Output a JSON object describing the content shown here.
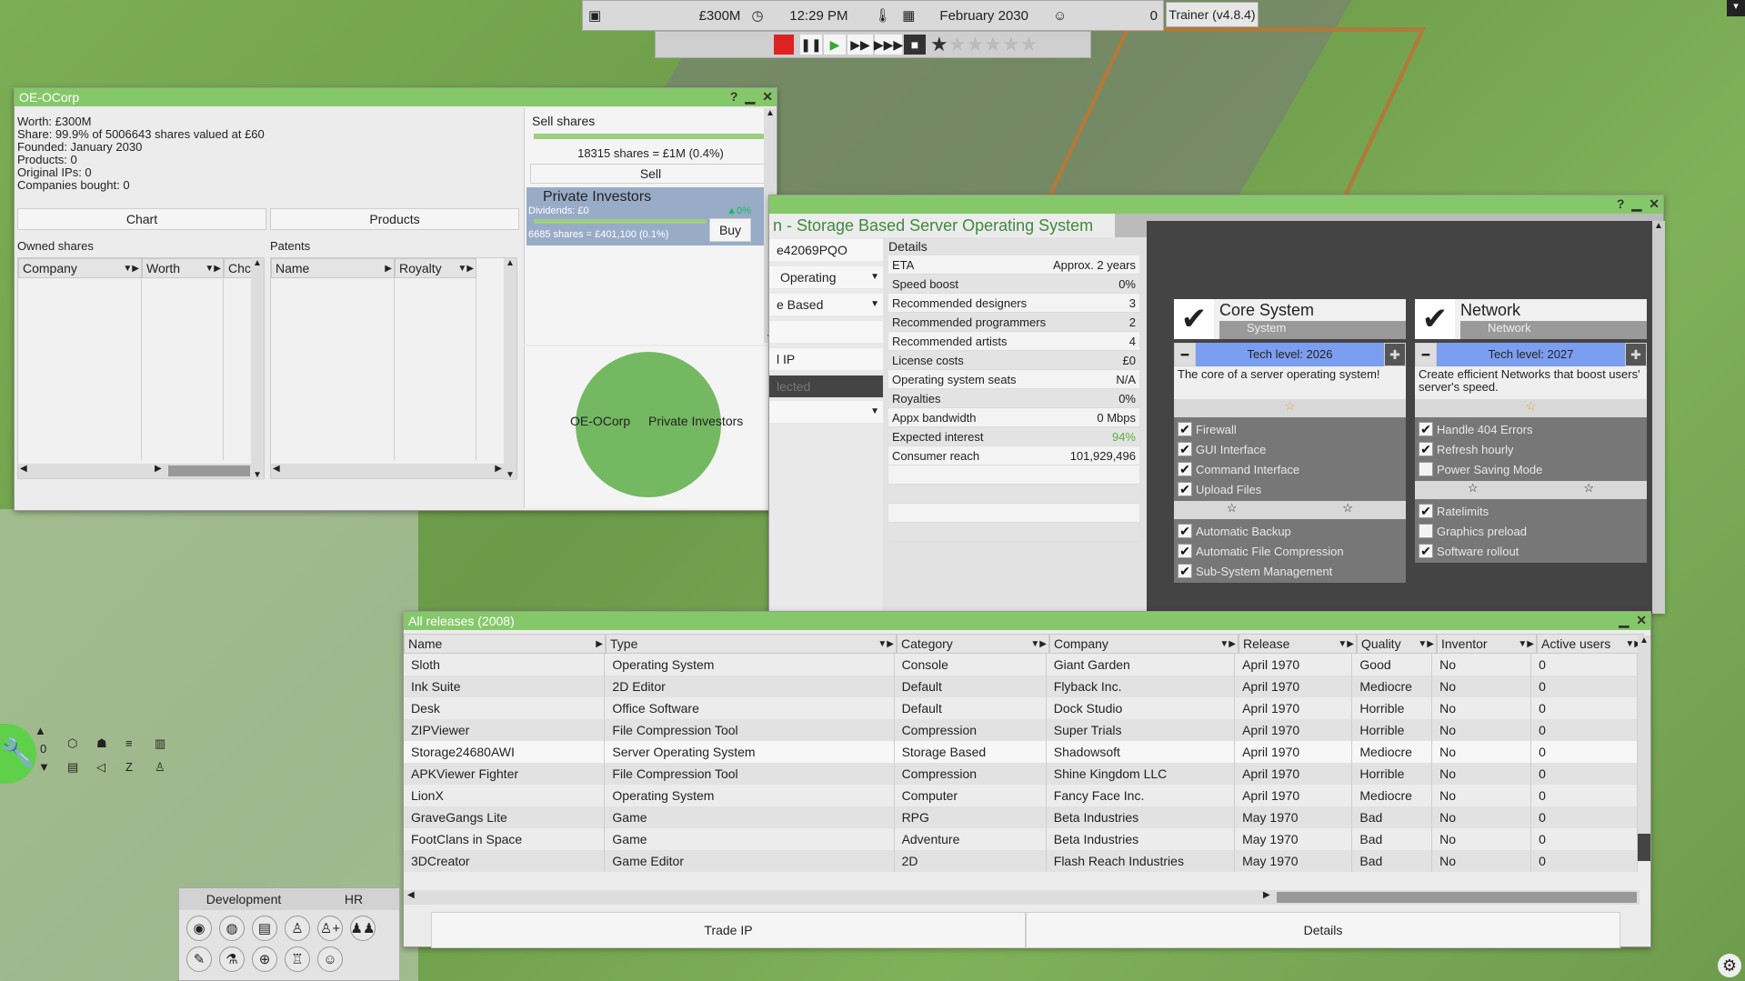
{
  "topbar": {
    "money": "£300M",
    "time": "12:29 PM",
    "date": "February 2030",
    "rating": "0",
    "trainer": "Trainer (v4.8.4)"
  },
  "company_window": {
    "title": "OE-OCorp",
    "info": [
      "Worth: £300M",
      "Share: 99.9% of 5006643 shares valued at £60",
      "Founded: January 2030",
      "Products: 0",
      "Original IPs: 0",
      "Companies bought: 0"
    ],
    "tab_chart": "Chart",
    "tab_products": "Products",
    "owned_label": "Owned shares",
    "owned_cols": [
      "Company",
      "Worth",
      "Chc"
    ],
    "patents_label": "Patents",
    "patents_cols": [
      "Name",
      "Royalty"
    ],
    "sell_label": "Sell shares",
    "sell_value": "18315 shares = £1M (0.4%)",
    "sell_button": "Sell",
    "investor_name": "Private Investors",
    "investor_div": "Dividends: £0",
    "investor_change": "▲0%",
    "investor_shares": "6685 shares = £401,100 (0.1%)",
    "buy_button": "Buy",
    "pie_labels": [
      "OE-OCorp",
      "Private Investors"
    ]
  },
  "design_window": {
    "title": "n - Storage Based Server Operating System",
    "left_fields": [
      "e42069PQO",
      "Operating",
      "e Based",
      "",
      "l IP",
      "lected",
      ""
    ],
    "details_label": "Details",
    "details": [
      {
        "k": "ETA",
        "v": "Approx. 2 years"
      },
      {
        "k": "Speed boost",
        "v": "0%"
      },
      {
        "k": "Recommended designers",
        "v": "3"
      },
      {
        "k": "Recommended programmers",
        "v": "2"
      },
      {
        "k": "Recommended artists",
        "v": "4"
      },
      {
        "k": "License costs",
        "v": "£0"
      },
      {
        "k": "Operating system seats",
        "v": "N/A"
      },
      {
        "k": "Royalties",
        "v": "0%"
      },
      {
        "k": "Appx bandwidth",
        "v": "0 Mbps"
      },
      {
        "k": "Expected interest",
        "v": "94%"
      },
      {
        "k": "Consumer reach",
        "v": "101,929,496"
      }
    ],
    "core": {
      "title": "Core System",
      "sub": "System",
      "tech": "Tech level: 2026",
      "desc": "The core of a server operating system!",
      "features": [
        "Firewall",
        "GUI Interface",
        "Command Interface",
        "Upload Files"
      ],
      "features2": [
        "Automatic Backup",
        "Automatic File Compression",
        "Sub-System Management"
      ]
    },
    "network": {
      "title": "Network",
      "sub": "Network",
      "tech": "Tech level: 2027",
      "desc": "Create efficient Networks that boost users' server's speed.",
      "features": [
        "Handle 404 Errors",
        "Refresh hourly",
        "Power Saving Mode"
      ],
      "features2": [
        "Ratelimits",
        "Graphics preload",
        "Software rollout"
      ]
    }
  },
  "releases_window": {
    "title": "All releases (2008)",
    "columns": [
      "Name",
      "Type",
      "Category",
      "Company",
      "Release",
      "Quality",
      "Inventor",
      "Active users"
    ],
    "rows": [
      [
        "Sloth",
        "Operating System",
        "Console",
        "Giant Garden",
        "April 1970",
        "Good",
        "No",
        "0"
      ],
      [
        "Ink Suite",
        "2D Editor",
        "Default",
        "Flyback Inc.",
        "April 1970",
        "Mediocre",
        "No",
        "0"
      ],
      [
        "Desk",
        "Office Software",
        "Default",
        "Dock Studio",
        "April 1970",
        "Horrible",
        "No",
        "0"
      ],
      [
        "ZIPViewer",
        "File Compression Tool",
        "Compression",
        "Super Trials",
        "April 1970",
        "Horrible",
        "No",
        "0"
      ],
      [
        "Storage24680AWI",
        "Server Operating System",
        "Storage Based",
        "Shadowsoft",
        "April 1970",
        "Mediocre",
        "No",
        "0"
      ],
      [
        "APKViewer Fighter",
        "File Compression Tool",
        "Compression",
        "Shine Kingdom LLC",
        "April 1970",
        "Horrible",
        "No",
        "0"
      ],
      [
        "LionX",
        "Operating System",
        "Computer",
        "Fancy Face Inc.",
        "April 1970",
        "Mediocre",
        "No",
        "0"
      ],
      [
        "GraveGangs Lite",
        "Game",
        "RPG",
        "Beta Industries",
        "May 1970",
        "Bad",
        "No",
        "0"
      ],
      [
        "FootClans in Space",
        "Game",
        "Adventure",
        "Beta Industries",
        "May 1970",
        "Bad",
        "No",
        "0"
      ],
      [
        "3DCreator",
        "Game Editor",
        "2D",
        "Flash Reach Industries",
        "May 1970",
        "Bad",
        "No",
        "0"
      ]
    ],
    "trade_button": "Trade IP",
    "details_button": "Details"
  },
  "bottom_panel": {
    "tab_dev": "Development",
    "tab_hr": "HR",
    "counter": "0"
  }
}
